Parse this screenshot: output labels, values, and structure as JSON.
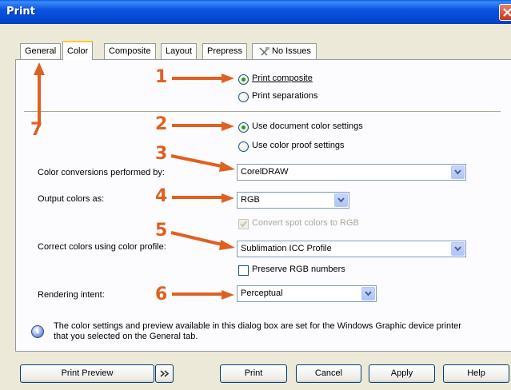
{
  "window": {
    "title": "Print"
  },
  "tabs": [
    {
      "label": "General"
    },
    {
      "label": "Color"
    },
    {
      "label": "Composite"
    },
    {
      "label": "Layout"
    },
    {
      "label": "Prepress"
    },
    {
      "label": "No Issues",
      "icon": "no-issues-icon"
    }
  ],
  "active_tab": "Color",
  "composite_group": {
    "print_composite": "Print composite",
    "print_separations": "Print separations",
    "selected": "Print composite"
  },
  "color_settings_group": {
    "use_document": "Use document color settings",
    "use_proof": "Use color proof settings",
    "selected": "Use document color settings"
  },
  "color_conversions": {
    "label": "Color conversions performed by:",
    "value": "CorelDRAW"
  },
  "output_colors": {
    "label": "Output colors as:",
    "value": "RGB"
  },
  "convert_spot": {
    "label": "Convert spot colors to RGB",
    "checked": true,
    "enabled": false
  },
  "correct_colors": {
    "label": "Correct colors using color profile:",
    "value": "Sublimation ICC Profile"
  },
  "preserve_rgb": {
    "label": "Preserve RGB numbers",
    "checked": false
  },
  "rendering_intent": {
    "label": "Rendering intent:",
    "value": "Perceptual"
  },
  "info": {
    "text": "The color settings and preview available in this dialog box are set for the Windows Graphic device printer that you selected on the General tab.",
    "icon": "info-icon"
  },
  "buttons": {
    "print_preview": "Print Preview",
    "expand": "»",
    "print": "Print",
    "cancel": "Cancel",
    "apply": "Apply",
    "help": "Help"
  },
  "annotations": {
    "numbers": [
      "1",
      "2",
      "3",
      "4",
      "5",
      "6",
      "7"
    ],
    "color": "#e06020"
  }
}
